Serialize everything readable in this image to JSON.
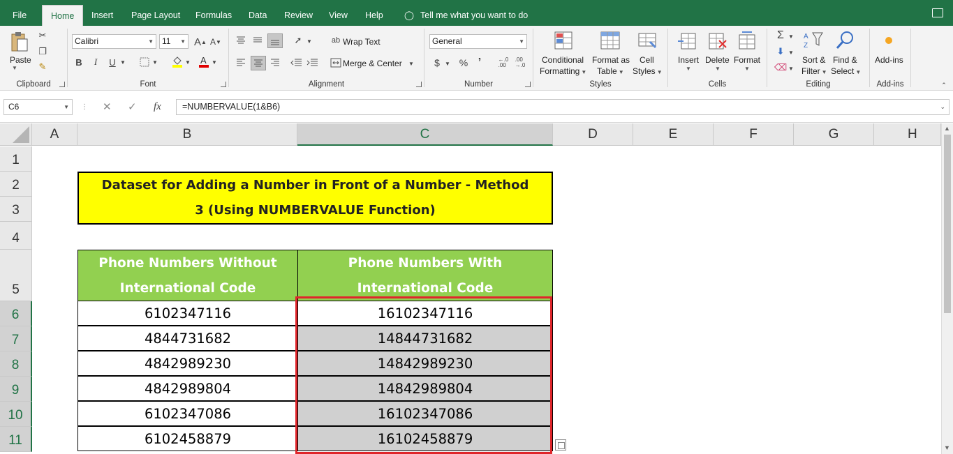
{
  "tabs": [
    {
      "label": "File",
      "active": false
    },
    {
      "label": "Home",
      "active": true
    },
    {
      "label": "Insert",
      "active": false
    },
    {
      "label": "Page Layout",
      "active": false
    },
    {
      "label": "Formulas",
      "active": false
    },
    {
      "label": "Data",
      "active": false
    },
    {
      "label": "Review",
      "active": false
    },
    {
      "label": "View",
      "active": false
    },
    {
      "label": "Help",
      "active": false
    }
  ],
  "tell_me": "Tell me what you want to do",
  "ribbon": {
    "clipboard": {
      "paste_label": "Paste",
      "group_label": "Clipboard"
    },
    "font": {
      "font_name": "Calibri",
      "font_size": "11",
      "bold": "B",
      "italic": "I",
      "underline": "U",
      "group_label": "Font"
    },
    "alignment": {
      "wrap_text": "Wrap Text",
      "merge_center": "Merge & Center",
      "group_label": "Alignment"
    },
    "number": {
      "format": "General",
      "currency": "$",
      "percent": "%",
      "comma": "’",
      "group_label": "Number"
    },
    "styles": {
      "conditional_1": "Conditional",
      "conditional_2": "Formatting",
      "format_table_1": "Format as",
      "format_table_2": "Table",
      "cell_styles_1": "Cell",
      "cell_styles_2": "Styles",
      "group_label": "Styles"
    },
    "cells": {
      "insert": "Insert",
      "delete": "Delete",
      "format": "Format",
      "group_label": "Cells"
    },
    "editing": {
      "sort_1": "Sort &",
      "sort_2": "Filter",
      "find_1": "Find &",
      "find_2": "Select",
      "group_label": "Editing"
    },
    "addins": {
      "label": "Add-ins",
      "group_label": "Add-ins"
    }
  },
  "formula_bar": {
    "name_box": "C6",
    "formula": "=NUMBERVALUE(1&B6)"
  },
  "columns": [
    "A",
    "B",
    "C",
    "D",
    "E",
    "F",
    "G",
    "H"
  ],
  "rows": [
    "1",
    "2",
    "3",
    "4",
    "5",
    "6",
    "7",
    "8",
    "9",
    "10",
    "11"
  ],
  "sheet": {
    "title_line1": "Dataset for Adding a Number in Front of a Number  - Method",
    "title_line2": "3 (Using NUMBERVALUE Function)",
    "header_b_1": "Phone Numbers Without",
    "header_b_2": "International Code",
    "header_c_1": "Phone Numbers With",
    "header_c_2": "International Code",
    "data": [
      {
        "b": "6102347116",
        "c": "16102347116"
      },
      {
        "b": "4844731682",
        "c": "14844731682"
      },
      {
        "b": "4842989230",
        "c": "14842989230"
      },
      {
        "b": "4842989804",
        "c": "14842989804"
      },
      {
        "b": "6102347086",
        "c": "16102347086"
      },
      {
        "b": "6102458879",
        "c": "16102458879"
      }
    ]
  }
}
